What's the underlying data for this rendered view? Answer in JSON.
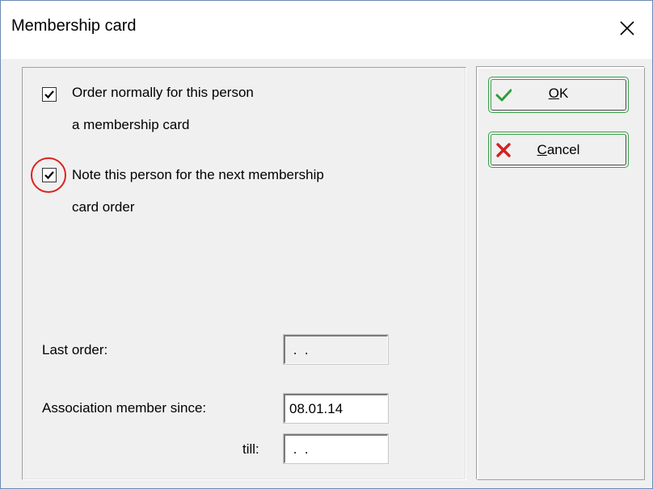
{
  "window": {
    "title": "Membership card",
    "close_icon": "close-icon"
  },
  "options": {
    "order_normally": {
      "checked": true,
      "line1": "Order normally for this person",
      "line2": "a membership card"
    },
    "note_next_order": {
      "checked": true,
      "highlighted": true,
      "line1": "Note this person for the next membership",
      "line2": "card order"
    }
  },
  "fields": {
    "last_order": {
      "label": "Last order:",
      "value": " .  ."
    },
    "member_since": {
      "label": "Association member since:",
      "value": "08.01.14"
    },
    "till": {
      "label": "till:",
      "value": " .  ."
    }
  },
  "buttons": {
    "ok": {
      "accel": "O",
      "rest": "K",
      "icon": "checkmark-icon"
    },
    "cancel": {
      "accel": "C",
      "rest": "ancel",
      "icon": "x-icon"
    }
  },
  "colors": {
    "button_border": "#3aa04a",
    "ok_icon": "#2f9e3a",
    "cancel_icon": "#d42020",
    "highlight_ring": "#e02020"
  }
}
